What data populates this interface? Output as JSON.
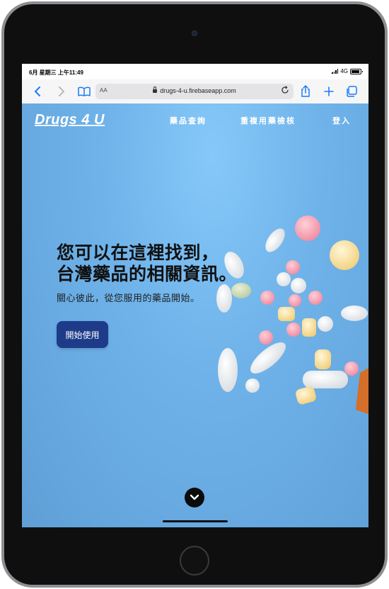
{
  "status": {
    "time": "6月 星期三 上午11:49",
    "network": "4G"
  },
  "browser": {
    "aa_label": "AA",
    "url": "drugs-4-u.firebaseapp.com",
    "icons": {
      "back": "chevron-left-icon",
      "forward": "chevron-right-icon",
      "bookmarks": "book-icon",
      "lock": "lock-icon",
      "reload": "reload-icon",
      "share": "share-icon",
      "new_tab": "plus-icon",
      "tabs": "tabs-icon"
    }
  },
  "site": {
    "brand": "Drugs 4 U",
    "nav": [
      "藥品查詢",
      "重複用藥檢核",
      "登入"
    ],
    "headline_line1": "您可以在這裡找到，",
    "headline_line2": "台灣藥品的相關資訊。",
    "subtitle": "關心彼此，從您服用的藥品開始。",
    "cta": "開始使用",
    "scroll_icon": "chevron-down-icon"
  },
  "colors": {
    "accent_button": "#1e3b8a",
    "page_background": "#6fb3ea",
    "browser_accent": "#1a7cf7"
  }
}
